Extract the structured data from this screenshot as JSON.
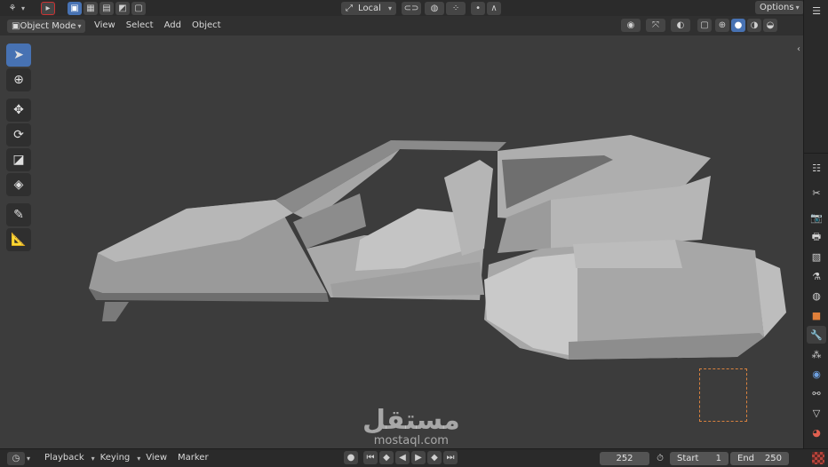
{
  "topbar": {
    "transform_orientation": "Local",
    "options_label": "Options"
  },
  "header": {
    "mode": "Object Mode",
    "menus": [
      "View",
      "Select",
      "Add",
      "Object"
    ]
  },
  "toolbar": {
    "tools": [
      "select-box",
      "cursor",
      "move",
      "rotate",
      "scale",
      "transform",
      "annotate",
      "measure"
    ]
  },
  "properties_tabs": [
    "tool",
    "render",
    "output",
    "view-layer",
    "scene",
    "world",
    "object",
    "modifiers",
    "particles",
    "physics",
    "constraints",
    "data",
    "material"
  ],
  "timeline": {
    "menus": [
      "Playback",
      "Keying",
      "View",
      "Marker"
    ],
    "current_frame": "252",
    "start_label": "Start",
    "start_value": "1",
    "end_label": "End",
    "end_value": "250"
  },
  "watermark": {
    "arabic": "مستقل",
    "latin": "mostaql.com"
  },
  "colors": {
    "accent": "#4772b3",
    "background": "#3c3c3c",
    "camera_frame": "#d9823f"
  }
}
